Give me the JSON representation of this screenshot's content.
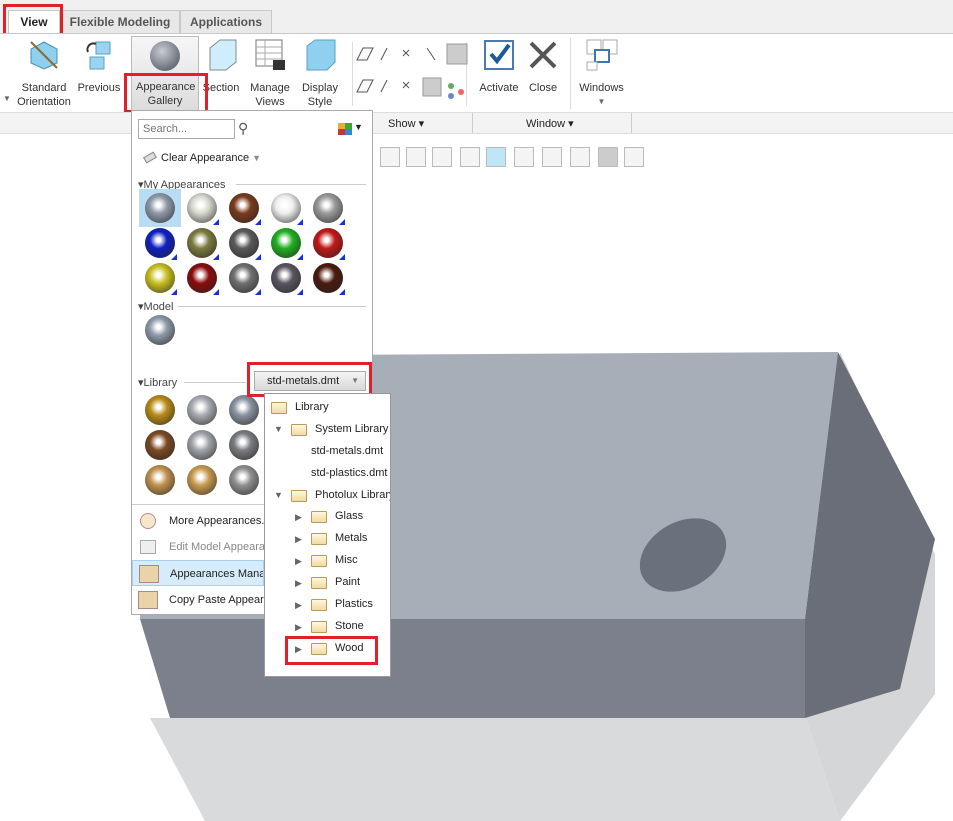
{
  "tabs": [
    {
      "label": "View"
    },
    {
      "label": "Flexible Modeling"
    },
    {
      "label": "Applications"
    }
  ],
  "ribbon": {
    "standard_orientation": "Standard Orientation",
    "previous": "Previous",
    "appearance_gallery": "Appearance Gallery",
    "section": "Section",
    "manage_views": "Manage Views",
    "display_style": "Display Style",
    "activate": "Activate",
    "close": "Close",
    "windows": "Windows",
    "groups": {
      "show": "Show",
      "window": "Window"
    }
  },
  "panel": {
    "search_placeholder": "Search...",
    "clear_appearance": "Clear Appearance",
    "my_appearances": "My Appearances",
    "model": "Model",
    "library": "Library",
    "library_select": "std-metals.dmt",
    "my_colors": [
      "#8e9aa8",
      "#d8d8d0",
      "#7a3a1c",
      "#eeeeee",
      "#9a9a9a",
      "#1020c0",
      "#7a7a40",
      "#5a5a5a",
      "#20b020",
      "#c01818",
      "#c8c020",
      "#8a0c0c",
      "#707070",
      "#5a5560",
      "#4a1a0e"
    ],
    "model_colors": [
      "#8e9aa8"
    ],
    "library_colors": [
      "#b88a18",
      "#a8acb2",
      "#8a92a0",
      "#7a4a22",
      "#a0a4aa",
      "#7a7c80",
      "#c0924e",
      "#c89a50",
      "#909090"
    ],
    "menu": [
      {
        "label": "More Appearances..."
      },
      {
        "label": "Edit Model Appearances"
      },
      {
        "label": "Appearances Manager"
      },
      {
        "label": "Copy Paste Appearances"
      }
    ]
  },
  "tree": {
    "root": "Library",
    "system": "System Library",
    "std_metals": "std-metals.dmt",
    "std_plastics": "std-plastics.dmt",
    "photolux": "Photolux Library",
    "folders": [
      {
        "label": "Glass"
      },
      {
        "label": "Metals"
      },
      {
        "label": "Misc"
      },
      {
        "label": "Paint"
      },
      {
        "label": "Plastics"
      },
      {
        "label": "Stone"
      },
      {
        "label": "Wood"
      }
    ]
  },
  "colors": {
    "highlight": "#e0202a",
    "selected": "#b8dcf4"
  }
}
